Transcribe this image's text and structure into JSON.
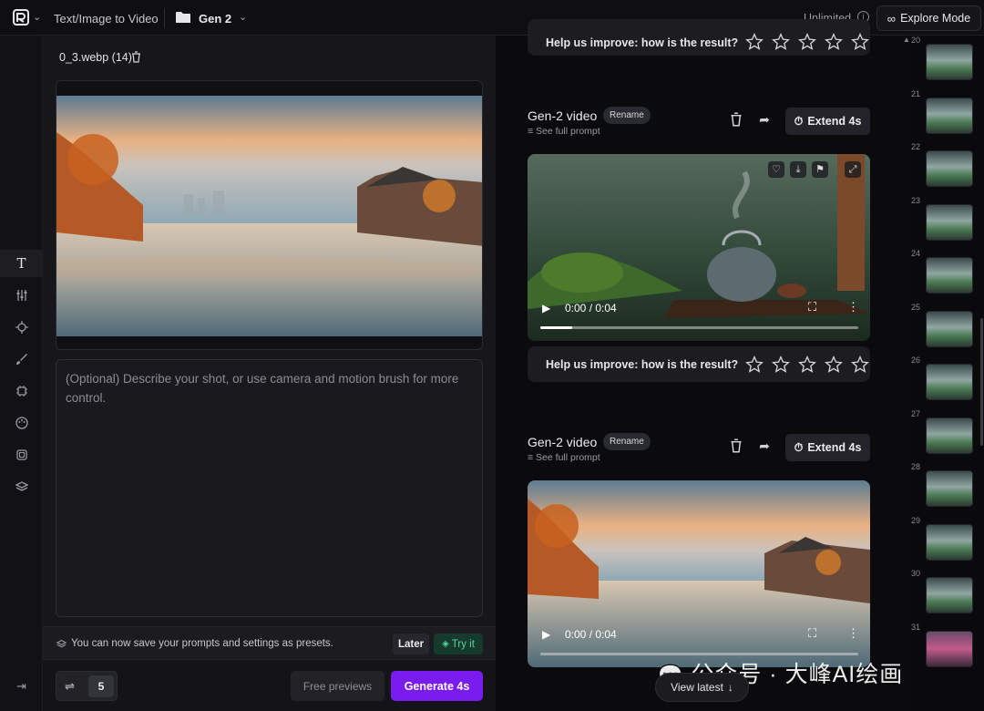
{
  "topbar": {
    "tool_name": "Text/Image to Video",
    "project_name": "Gen 2",
    "plan_label": "Unlimited",
    "explore_label": "Explore Mode"
  },
  "rail": {
    "icons": [
      "text-icon",
      "sliders-icon",
      "camera-motion-icon",
      "brush-icon",
      "settings-chip-icon",
      "palette-icon",
      "frame-icon",
      "layers-icon",
      "collapse-icon"
    ]
  },
  "left": {
    "file_name": "0_3.webp (14)",
    "prompt_placeholder": "(Optional) Describe your shot, or use camera and motion brush for more control.",
    "preset_notice": "You can now save your prompts and settings as presets.",
    "later_label": "Later",
    "tryit_label": "Try it",
    "settings_count": "5",
    "free_previews_label": "Free previews",
    "generate_label": "Generate 4s"
  },
  "feed": {
    "help_text": "Help us improve: how is the result?",
    "items": [
      {
        "title": "Gen-2 video",
        "rename": "Rename",
        "see_full": "See full prompt",
        "extend": "Extend 4s",
        "time": "0:00 / 0:04",
        "progress": 0.1
      },
      {
        "title": "Gen-2 video",
        "rename": "Rename",
        "see_full": "See full prompt",
        "extend": "Extend 4s",
        "time": "0:00 / 0:04",
        "progress": 0
      }
    ],
    "view_latest": "View latest"
  },
  "timeline": {
    "numbers": [
      "20",
      "21",
      "22",
      "23",
      "24",
      "25",
      "26",
      "27",
      "28",
      "29",
      "30",
      "31"
    ]
  },
  "watermark": "公众号 · 大峰AI绘画",
  "colors": {
    "accent": "#7a1cf0",
    "tryit_bg": "#163a2c",
    "tryit_fg": "#56d6a2"
  }
}
